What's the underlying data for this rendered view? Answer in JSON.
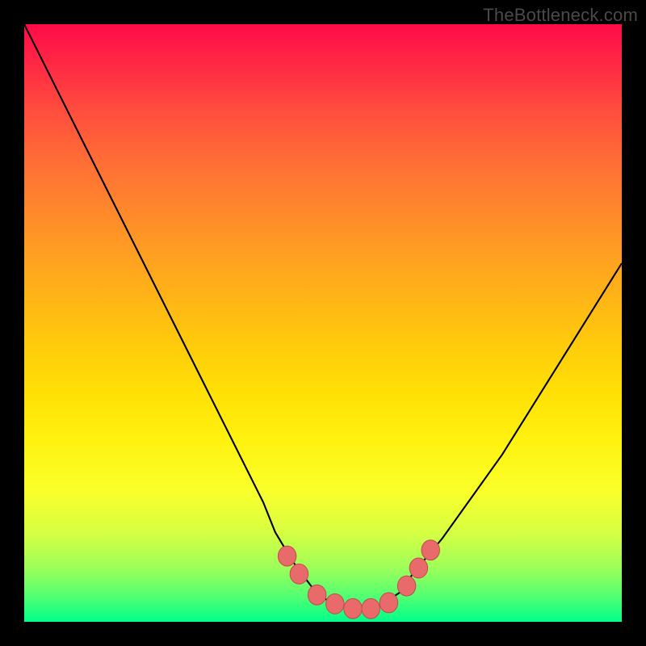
{
  "watermark": "TheBottleneck.com",
  "colors": {
    "gradient_top": "#ff0b49",
    "gradient_mid": "#ffe106",
    "gradient_bottom": "#00ff8a",
    "curve": "#000000",
    "marker_fill": "#e96a6a",
    "marker_stroke": "#c24b4b",
    "frame": "#000000"
  },
  "chart_data": {
    "type": "line",
    "title": "",
    "xlabel": "",
    "ylabel": "",
    "xlim": [
      0,
      100
    ],
    "ylim": [
      0,
      100
    ],
    "grid": false,
    "legend": false,
    "series": [
      {
        "name": "bottleneck-curve",
        "x": [
          0,
          5,
          10,
          15,
          20,
          25,
          30,
          35,
          40,
          42,
          45,
          48,
          50,
          52,
          55,
          58,
          60,
          63,
          65,
          70,
          75,
          80,
          85,
          90,
          95,
          100
        ],
        "y": [
          100,
          90,
          80,
          70,
          60,
          50,
          40,
          30,
          20,
          15,
          10,
          6,
          4,
          3,
          2,
          2,
          3,
          5,
          8,
          14,
          21,
          28,
          36,
          44,
          52,
          60
        ]
      }
    ],
    "markers": {
      "name": "highlight-points",
      "points": [
        {
          "x": 44,
          "y": 11
        },
        {
          "x": 46,
          "y": 8
        },
        {
          "x": 49,
          "y": 4.5
        },
        {
          "x": 52,
          "y": 3
        },
        {
          "x": 55,
          "y": 2.2
        },
        {
          "x": 58,
          "y": 2.2
        },
        {
          "x": 61,
          "y": 3.2
        },
        {
          "x": 64,
          "y": 6
        },
        {
          "x": 66,
          "y": 9
        },
        {
          "x": 68,
          "y": 12
        }
      ],
      "radius_data_units": 1.6
    },
    "annotations": []
  }
}
